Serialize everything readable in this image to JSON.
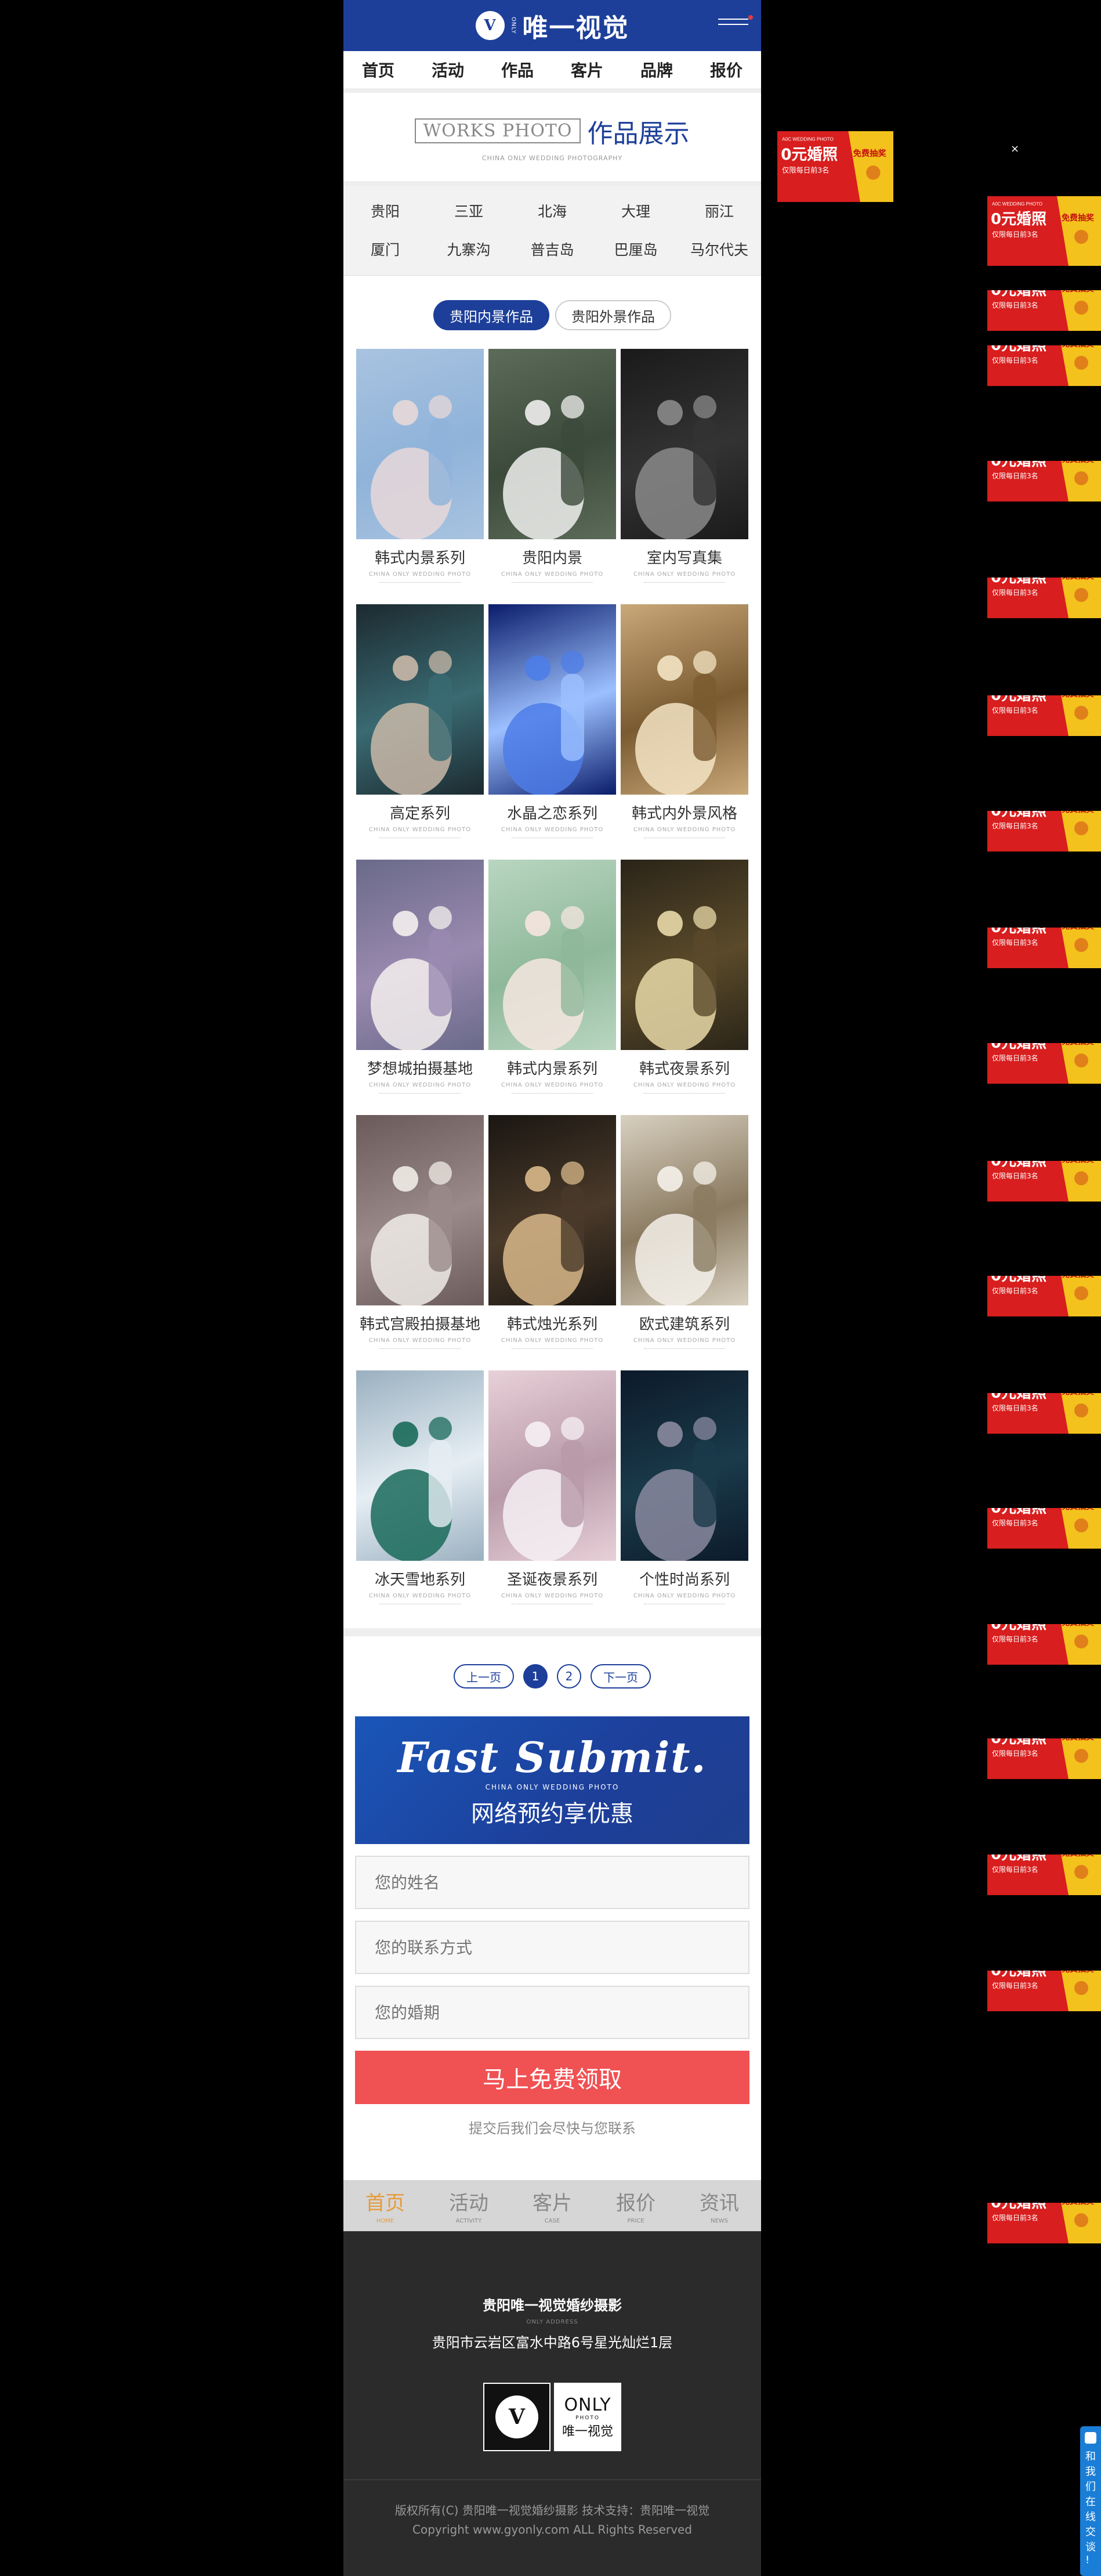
{
  "header": {
    "logo_letter": "V",
    "logo_small": "ONLY",
    "logo_name": "唯一视觉"
  },
  "nav": [
    "首页",
    "活动",
    "作品",
    "客片",
    "品牌",
    "报价"
  ],
  "works": {
    "title_en": "WORKS PHOTO",
    "title_cn": "作品展示",
    "subtitle": "CHINA ONLY WEDDING PHOTOGRAPHY"
  },
  "cities_row1": [
    "贵阳",
    "三亚",
    "北海",
    "大理",
    "丽江"
  ],
  "cities_row2": [
    "厦门",
    "九寨沟",
    "普吉岛",
    "巴厘岛",
    "马尔代夫"
  ],
  "tabs": [
    {
      "label": "贵阳内景作品",
      "active": true
    },
    {
      "label": "贵阳外景作品",
      "active": false
    }
  ],
  "card_subtitle": "CHINA ONLY WEDDING PHOTO",
  "cards": [
    {
      "title": "韩式内景系列",
      "palette": [
        "#a9c3e0",
        "#e8d8d8",
        "#8fb3d9"
      ]
    },
    {
      "title": "贵阳内景",
      "palette": [
        "#5d6b5a",
        "#f0f0ee",
        "#3b4a3a"
      ]
    },
    {
      "title": "室内写真集",
      "palette": [
        "#1a1a1a",
        "#8a8a8a",
        "#333333"
      ]
    },
    {
      "title": "高定系列",
      "palette": [
        "#1c2a30",
        "#c9b8a8",
        "#3a6a72"
      ]
    },
    {
      "title": "水晶之恋系列",
      "palette": [
        "#0a1c6a",
        "#4d7de8",
        "#9cc0ff"
      ]
    },
    {
      "title": "韩式内外景风格",
      "palette": [
        "#c9a97a",
        "#f3e4c4",
        "#7a5a30"
      ]
    },
    {
      "title": "梦想城拍摄基地",
      "palette": [
        "#6a6a8a",
        "#f4f0ee",
        "#9a8ab0"
      ]
    },
    {
      "title": "韩式内景系列",
      "palette": [
        "#b9d6c0",
        "#f6e6e0",
        "#8fb89a"
      ]
    },
    {
      "title": "韩式夜景系列",
      "palette": [
        "#2a2418",
        "#e9d9a8",
        "#5a4a2a"
      ]
    },
    {
      "title": "韩式宫殿拍摄基地",
      "palette": [
        "#6a5a5a",
        "#f0ece6",
        "#9a8a8a"
      ]
    },
    {
      "title": "韩式烛光系列",
      "palette": [
        "#1a1612",
        "#d9b98a",
        "#4a3a2a"
      ]
    },
    {
      "title": "欧式建筑系列",
      "palette": [
        "#d8d0c0",
        "#f5f1ea",
        "#8a7a60"
      ]
    },
    {
      "title": "冰天雪地系列",
      "palette": [
        "#9ab0c0",
        "#1a6a5a",
        "#e6eef4"
      ]
    },
    {
      "title": "圣诞夜景系列",
      "palette": [
        "#e8d0d8",
        "#f6f0f4",
        "#b89aa8"
      ]
    },
    {
      "title": "个性时尚系列",
      "palette": [
        "#0c1a2a",
        "#8a8aa0",
        "#1a3a4a"
      ]
    }
  ],
  "pager": {
    "prev": "上一页",
    "pages": [
      "1",
      "2"
    ],
    "next": "下一页"
  },
  "banner": {
    "en": "Fast Submit.",
    "small": "CHINA ONLY WEDDING PHOTO",
    "cn": "网络预约享优惠"
  },
  "form": {
    "name_placeholder": "您的姓名",
    "contact_placeholder": "您的联系方式",
    "date_placeholder": "您的婚期",
    "submit": "马上免费领取",
    "note": "提交后我们会尽快与您联系"
  },
  "footnav": [
    {
      "cn": "首页",
      "en": "HOME",
      "active": true
    },
    {
      "cn": "活动",
      "en": "ACTIVITY",
      "active": false
    },
    {
      "cn": "客片",
      "en": "CASE",
      "active": false
    },
    {
      "cn": "报价",
      "en": "PRICE",
      "active": false
    },
    {
      "cn": "资讯",
      "en": "NEWS",
      "active": false
    }
  ],
  "footer": {
    "company": "贵阳唯一视觉婚纱摄影",
    "address_label": "ONLY ADDRESS",
    "address": "贵阳市云岩区富水中路6号星光灿烂1层",
    "logo_letter": "V",
    "logo2_a": "ONLY",
    "logo2_b": "PHOTO",
    "logo2_c": "唯一视觉",
    "copyright": "版权所有(C) 贵阳唯一视觉婚纱摄影 技术支持：贵阳唯一视觉",
    "copyright2": "Copyright www.gyonly.com ALL Rights Reserved"
  },
  "ad": {
    "top": "A0C WEDDING PHOTO",
    "main": "0元婚照",
    "sub": "仅限每日前3名",
    "badge": "免费抽奖",
    "close": "×"
  },
  "side_ad_count": 18,
  "chat": {
    "label": "和我们在线交谈!"
  }
}
